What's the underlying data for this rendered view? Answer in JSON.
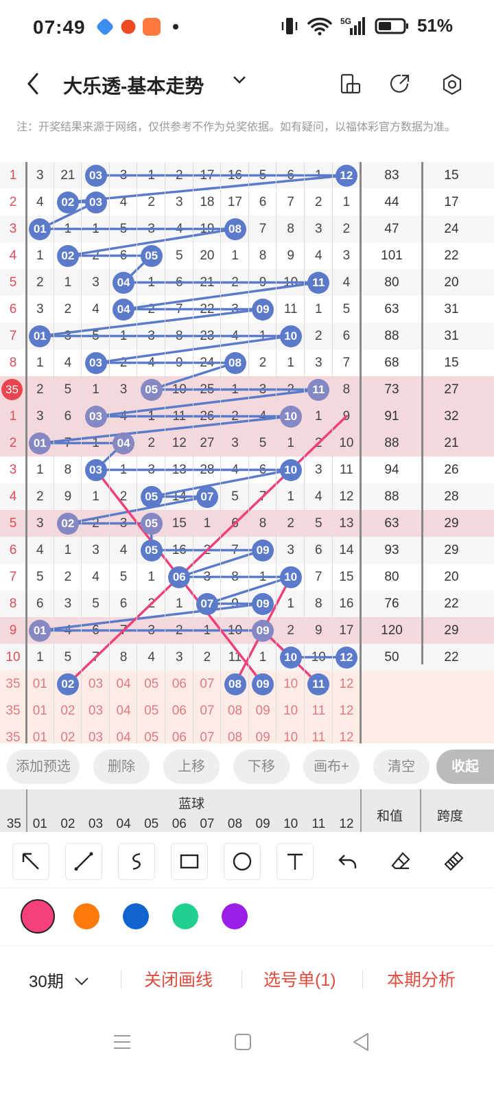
{
  "status": {
    "time": "07:49",
    "battery": "51%",
    "network": "5G"
  },
  "header": {
    "title": "大乐透-基本走势"
  },
  "note": "注：开奖结果来源于网络，仅供参考不作为兑奖依据。如有疑问，以福体彩官方数据为准。",
  "grid": {
    "rows": [
      {
        "idx": "1",
        "cells": [
          "3",
          "21",
          "03",
          "3",
          "1",
          "2",
          "17",
          "16",
          "5",
          "6",
          "1",
          "12"
        ],
        "sum": "83",
        "span": "15",
        "hl": false,
        "balls": [
          2,
          11
        ]
      },
      {
        "idx": "2",
        "cells": [
          "4",
          "02",
          "03",
          "4",
          "2",
          "3",
          "18",
          "17",
          "6",
          "7",
          "2",
          "1"
        ],
        "sum": "44",
        "span": "17",
        "hl": false,
        "balls": [
          1,
          2
        ]
      },
      {
        "idx": "3",
        "cells": [
          "01",
          "1",
          "1",
          "5",
          "3",
          "4",
          "19",
          "08",
          "7",
          "8",
          "3",
          "2"
        ],
        "sum": "47",
        "span": "24",
        "hl": false,
        "balls": [
          0,
          7
        ]
      },
      {
        "idx": "4",
        "cells": [
          "1",
          "02",
          "2",
          "6",
          "05",
          "5",
          "20",
          "1",
          "8",
          "9",
          "4",
          "3"
        ],
        "sum": "101",
        "span": "22",
        "hl": false,
        "balls": [
          1,
          4
        ]
      },
      {
        "idx": "5",
        "cells": [
          "2",
          "1",
          "3",
          "04",
          "1",
          "6",
          "21",
          "2",
          "9",
          "10",
          "11",
          "4"
        ],
        "sum": "80",
        "span": "20",
        "hl": false,
        "balls": [
          3,
          10
        ]
      },
      {
        "idx": "6",
        "cells": [
          "3",
          "2",
          "4",
          "04",
          "2",
          "7",
          "22",
          "3",
          "09",
          "11",
          "1",
          "5"
        ],
        "sum": "63",
        "span": "31",
        "hl": false,
        "balls": [
          3,
          8
        ]
      },
      {
        "idx": "7",
        "cells": [
          "01",
          "3",
          "5",
          "1",
          "3",
          "8",
          "23",
          "4",
          "1",
          "10",
          "2",
          "6"
        ],
        "sum": "88",
        "span": "31",
        "hl": false,
        "balls": [
          0,
          9
        ]
      },
      {
        "idx": "8",
        "cells": [
          "1",
          "4",
          "03",
          "2",
          "4",
          "9",
          "24",
          "08",
          "2",
          "1",
          "3",
          "7"
        ],
        "sum": "68",
        "span": "15",
        "hl": false,
        "balls": [
          2,
          7
        ]
      },
      {
        "idx": "35",
        "cells": [
          "2",
          "5",
          "1",
          "3",
          "05",
          "10",
          "25",
          "1",
          "3",
          "2",
          "11",
          "8"
        ],
        "sum": "73",
        "span": "27",
        "hl": true,
        "balls": [
          4,
          10
        ]
      },
      {
        "idx": "1",
        "cells": [
          "3",
          "6",
          "03",
          "4",
          "1",
          "11",
          "26",
          "2",
          "4",
          "10",
          "1",
          "9"
        ],
        "sum": "91",
        "span": "32",
        "hl": true,
        "balls": [
          2,
          9
        ]
      },
      {
        "idx": "2",
        "cells": [
          "01",
          "7",
          "1",
          "04",
          "2",
          "12",
          "27",
          "3",
          "5",
          "1",
          "2",
          "10"
        ],
        "sum": "88",
        "span": "21",
        "hl": true,
        "balls": [
          0,
          3
        ]
      },
      {
        "idx": "3",
        "cells": [
          "1",
          "8",
          "03",
          "1",
          "3",
          "13",
          "28",
          "4",
          "6",
          "10",
          "3",
          "11"
        ],
        "sum": "94",
        "span": "26",
        "hl": false,
        "balls": [
          2,
          9
        ]
      },
      {
        "idx": "4",
        "cells": [
          "2",
          "9",
          "1",
          "2",
          "05",
          "14",
          "07",
          "5",
          "7",
          "1",
          "4",
          "12"
        ],
        "sum": "88",
        "span": "28",
        "hl": false,
        "balls": [
          4,
          6
        ]
      },
      {
        "idx": "5",
        "cells": [
          "3",
          "02",
          "2",
          "3",
          "05",
          "15",
          "1",
          "6",
          "8",
          "2",
          "5",
          "13"
        ],
        "sum": "63",
        "span": "29",
        "hl": true,
        "balls": [
          1,
          4
        ]
      },
      {
        "idx": "6",
        "cells": [
          "4",
          "1",
          "3",
          "4",
          "05",
          "16",
          "2",
          "7",
          "09",
          "3",
          "6",
          "14"
        ],
        "sum": "93",
        "span": "29",
        "hl": false,
        "balls": [
          4,
          8
        ]
      },
      {
        "idx": "7",
        "cells": [
          "5",
          "2",
          "4",
          "5",
          "1",
          "06",
          "3",
          "8",
          "1",
          "10",
          "7",
          "15"
        ],
        "sum": "80",
        "span": "20",
        "hl": false,
        "balls": [
          5,
          9
        ]
      },
      {
        "idx": "8",
        "cells": [
          "6",
          "3",
          "5",
          "6",
          "2",
          "1",
          "07",
          "9",
          "09",
          "1",
          "8",
          "16"
        ],
        "sum": "76",
        "span": "22",
        "hl": false,
        "balls": [
          6,
          8
        ]
      },
      {
        "idx": "9",
        "cells": [
          "01",
          "4",
          "6",
          "7",
          "3",
          "2",
          "1",
          "10",
          "09",
          "2",
          "9",
          "17"
        ],
        "sum": "120",
        "span": "29",
        "hl": true,
        "balls": [
          0,
          8
        ]
      },
      {
        "idx": "10",
        "cells": [
          "1",
          "5",
          "7",
          "8",
          "4",
          "3",
          "2",
          "11",
          "1",
          "10",
          "10",
          "12"
        ],
        "sum": "50",
        "span": "22",
        "hl": false,
        "balls": [
          9,
          11
        ]
      }
    ],
    "predict": [
      {
        "idx": "35",
        "cells": [
          "01",
          "02",
          "03",
          "04",
          "05",
          "06",
          "07",
          "08",
          "09",
          "10",
          "11",
          "12"
        ],
        "balls": [
          1,
          7,
          8,
          10
        ]
      },
      {
        "idx": "35",
        "cells": [
          "01",
          "02",
          "03",
          "04",
          "05",
          "06",
          "07",
          "08",
          "09",
          "10",
          "11",
          "12"
        ],
        "balls": []
      },
      {
        "idx": "35",
        "cells": [
          "01",
          "02",
          "03",
          "04",
          "05",
          "06",
          "07",
          "08",
          "09",
          "10",
          "11",
          "12"
        ],
        "balls": []
      }
    ]
  },
  "actions": [
    "添加预选",
    "删除",
    "上移",
    "下移",
    "画布+",
    "清空",
    "收起"
  ],
  "bottom_header": {
    "section": "蓝球",
    "sum": "和值",
    "span": "跨度",
    "first": "35",
    "cols": [
      "01",
      "02",
      "03",
      "04",
      "05",
      "06",
      "07",
      "08",
      "09",
      "10",
      "11",
      "12"
    ]
  },
  "tools": [
    "arrow-tool",
    "line-tool",
    "curve-tool",
    "rect-tool",
    "circle-tool",
    "text-tool",
    "undo-tool",
    "eraser-tool",
    "clear-tool"
  ],
  "palette": [
    "#f5407a",
    "#ff7a0c",
    "#1163cf",
    "#21d08f",
    "#9b1ee8"
  ],
  "bottom": {
    "period": "30期",
    "close_draw": "关闭画线",
    "pick_list": "选号单(1)",
    "analysis": "本期分析"
  }
}
